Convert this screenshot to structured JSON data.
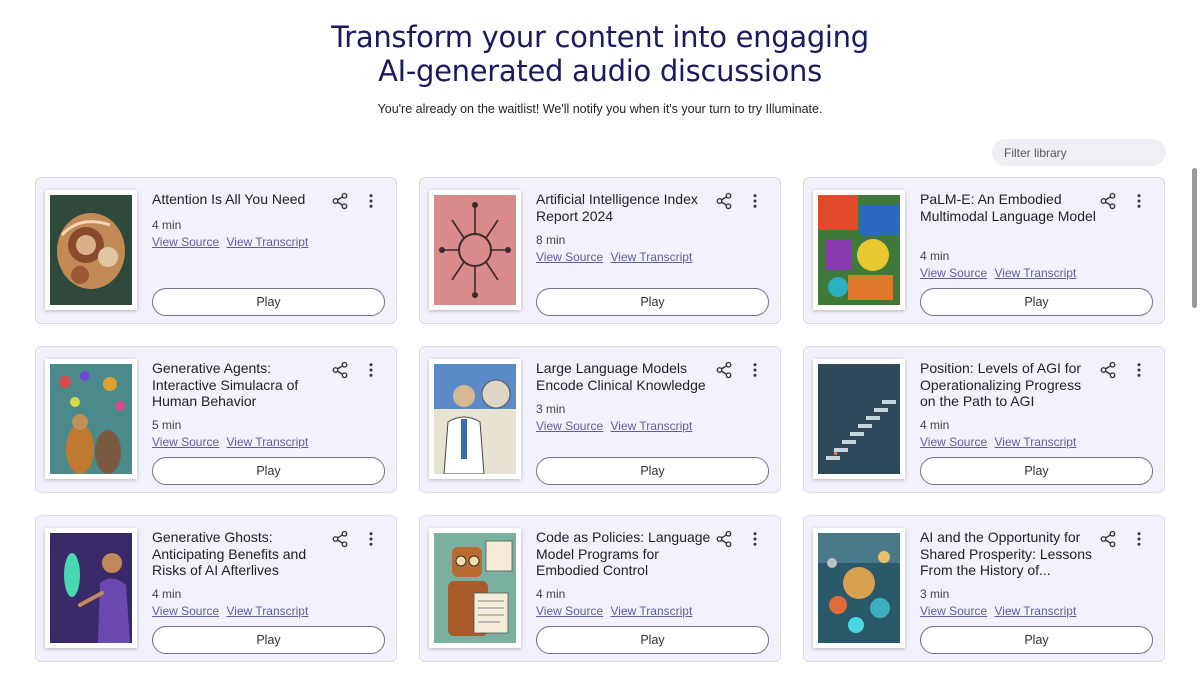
{
  "hero": {
    "line1": "Transform your content into engaging",
    "line2": "AI-generated audio discussions",
    "waitlist": "You're already on the waitlist! We'll notify you when it's your turn to try Illuminate."
  },
  "filter": {
    "placeholder": "Filter library"
  },
  "labels": {
    "view_source": "View Source",
    "view_transcript": "View Transcript",
    "play": "Play"
  },
  "icons": {
    "share": "share-icon",
    "more": "more-vert-icon",
    "search": "search-icon"
  },
  "cards": [
    {
      "title": "Attention Is All You Need",
      "duration": "4 min"
    },
    {
      "title": "Artificial Intelligence Index Report 2024",
      "duration": "8 min"
    },
    {
      "title": "PaLM-E: An Embodied Multimodal Language Model",
      "duration": "4 min"
    },
    {
      "title": "Generative Agents: Interactive Simulacra of Human Behavior",
      "duration": "5 min"
    },
    {
      "title": "Large Language Models Encode Clinical Knowledge",
      "duration": "3 min"
    },
    {
      "title": "Position: Levels of AGI for Operationalizing Progress on the Path to AGI",
      "duration": "4 min"
    },
    {
      "title": "Generative Ghosts: Anticipating Benefits and Risks of AI Afterlives",
      "duration": "4 min"
    },
    {
      "title": "Code as Policies: Language Model Programs for Embodied Control",
      "duration": "4 min"
    },
    {
      "title": "AI and the Opportunity for Shared Prosperity: Lessons From the History of...",
      "duration": "3 min"
    }
  ]
}
